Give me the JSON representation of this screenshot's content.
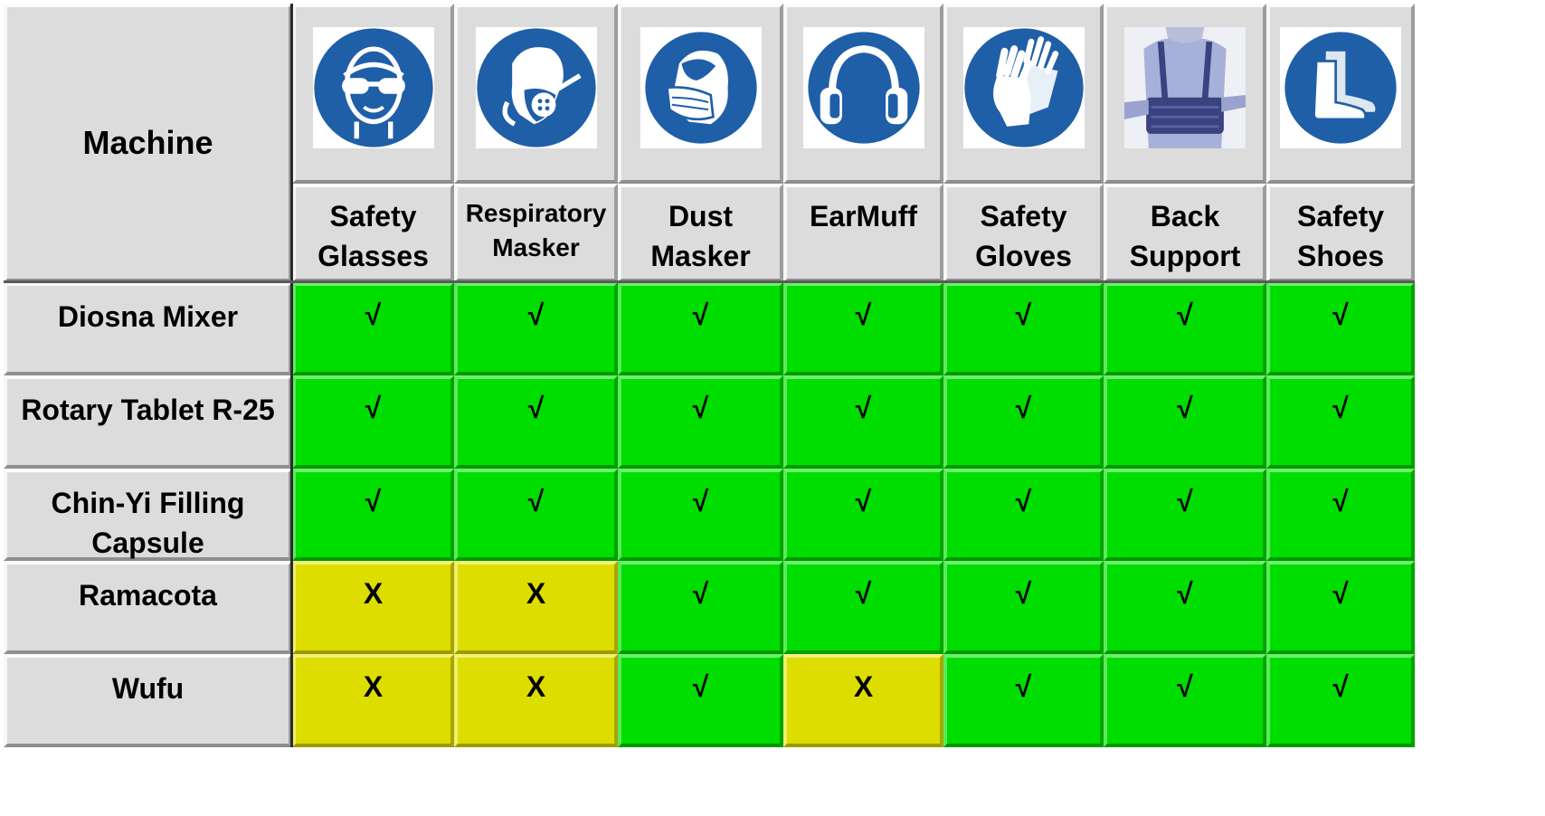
{
  "table": {
    "corner_label": "Machine",
    "columns": [
      {
        "key": "safety-glasses",
        "label": "Safety Glasses",
        "icon": "safety-glasses-icon"
      },
      {
        "key": "respiratory-masker",
        "label": "Respiratory Masker",
        "icon": "respirator-icon"
      },
      {
        "key": "dust-masker",
        "label": "Dust Masker",
        "icon": "dust-mask-icon"
      },
      {
        "key": "earmuff",
        "label": "EarMuff",
        "icon": "earmuff-icon"
      },
      {
        "key": "safety-gloves",
        "label": "Safety Gloves",
        "icon": "safety-gloves-icon"
      },
      {
        "key": "back-support",
        "label": "Back Support",
        "icon": "back-support-icon"
      },
      {
        "key": "safety-shoes",
        "label": "Safety Shoes",
        "icon": "safety-shoes-icon"
      }
    ],
    "rows": [
      {
        "machine": "Diosna Mixer",
        "cells": [
          "√",
          "√",
          "√",
          "√",
          "√",
          "√",
          "√"
        ]
      },
      {
        "machine": "Rotary Tablet R-25",
        "cells": [
          "√",
          "√",
          "√",
          "√",
          "√",
          "√",
          "√"
        ]
      },
      {
        "machine": "Chin-Yi Filling Capsule",
        "cells": [
          "√",
          "√",
          "√",
          "√",
          "√",
          "√",
          "√"
        ]
      },
      {
        "machine": "Ramacota",
        "cells": [
          "X",
          "X",
          "√",
          "√",
          "√",
          "√",
          "√"
        ]
      },
      {
        "machine": "Wufu",
        "cells": [
          "X",
          "X",
          "√",
          "X",
          "√",
          "√",
          "√"
        ]
      }
    ]
  },
  "colors": {
    "required": "#00dd00",
    "not_required": "#dddd00",
    "header": "#dcdcdc",
    "sign_blue": "#1f5fa8"
  }
}
